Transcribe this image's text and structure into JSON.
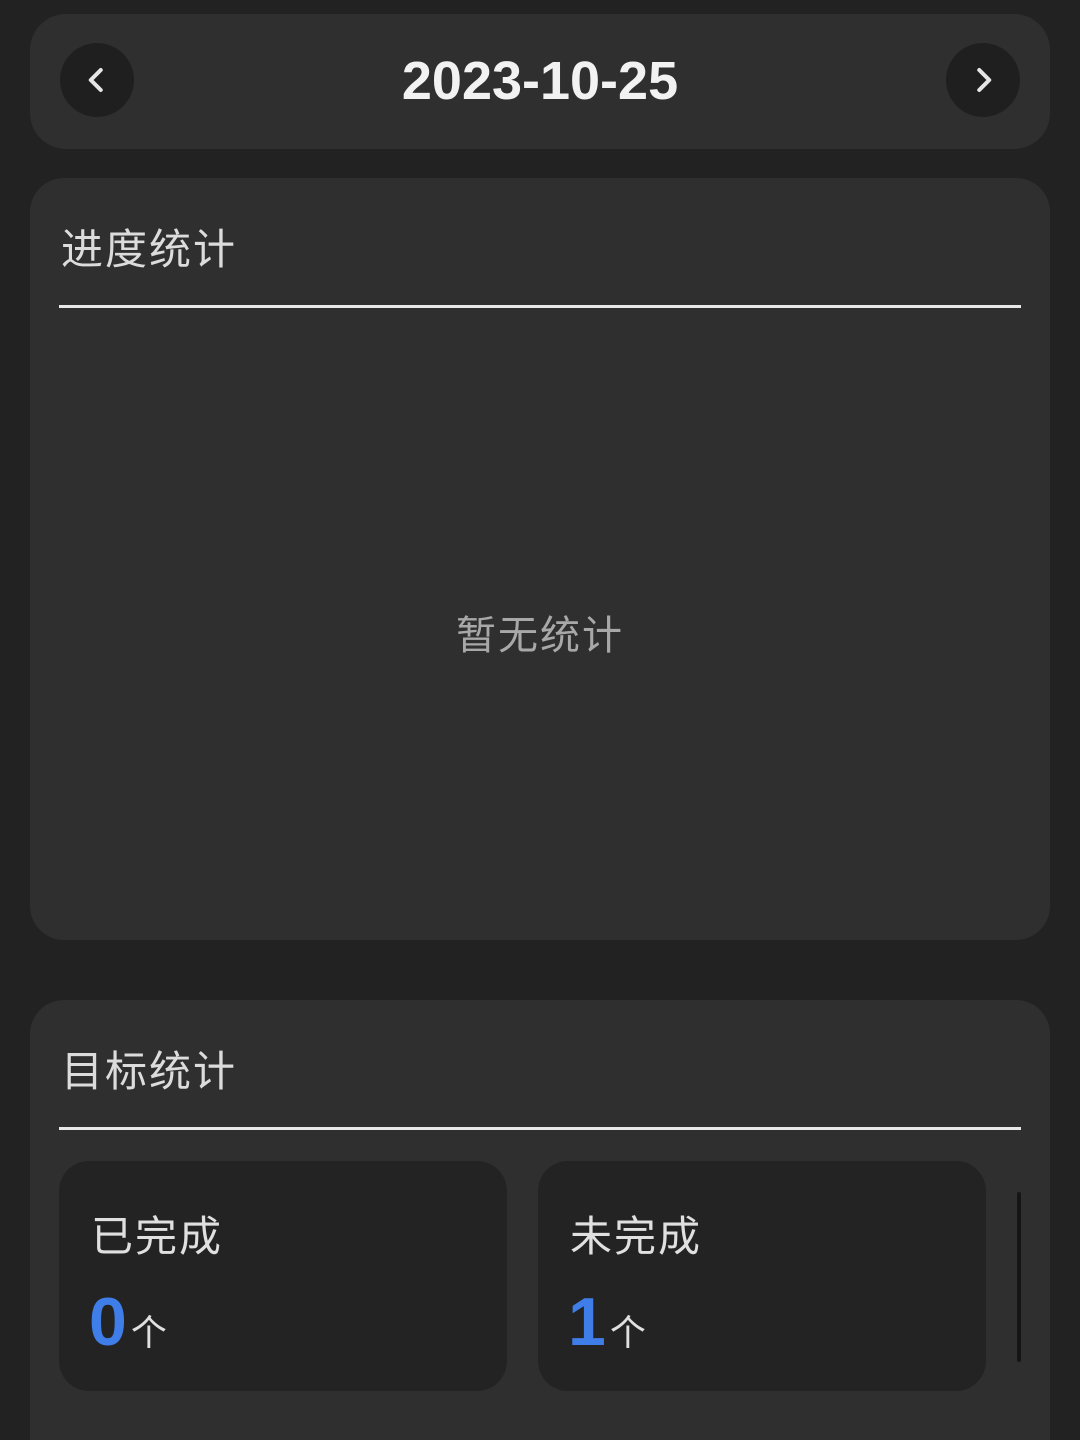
{
  "date_nav": {
    "date": "2023-10-25"
  },
  "progress_card": {
    "title": "进度统计",
    "empty_text": "暂无统计"
  },
  "goals_card": {
    "title": "目标统计",
    "stats": [
      {
        "label": "已完成",
        "value": "0",
        "unit": "个"
      },
      {
        "label": "未完成",
        "value": "1",
        "unit": "个"
      }
    ]
  },
  "colors": {
    "background": "#222222",
    "card": "#2f2f2f",
    "accent": "#3f7ee8"
  },
  "icons": {
    "prev": "chevron-left-icon",
    "next": "chevron-right-icon"
  }
}
